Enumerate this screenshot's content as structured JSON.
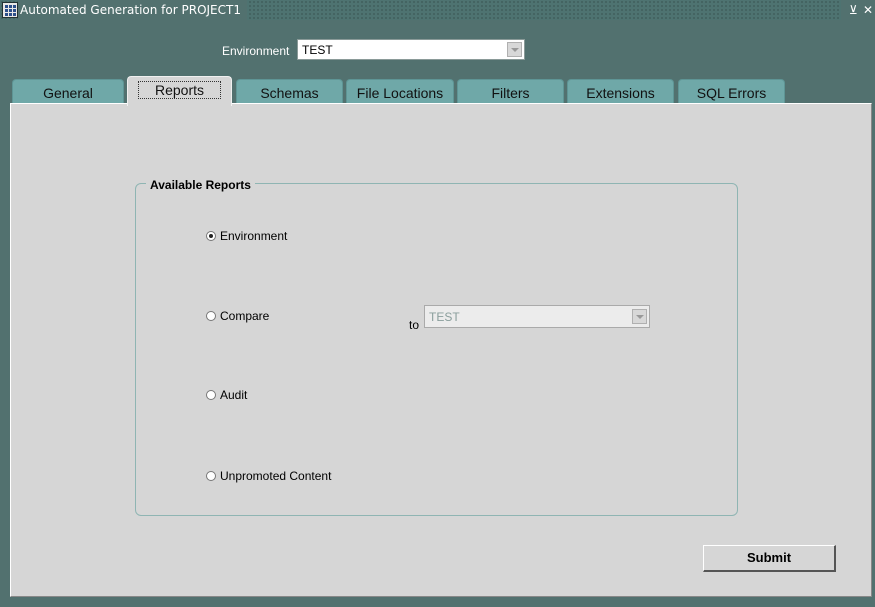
{
  "window": {
    "title": "Automated Generation for PROJECT1",
    "buttons": {
      "minimize": "⊻",
      "close": "✕"
    }
  },
  "environment": {
    "label": "Environment",
    "value": "TEST"
  },
  "tabs": [
    {
      "label": "General",
      "active": false
    },
    {
      "label": "Reports",
      "active": true
    },
    {
      "label": "Schemas",
      "active": false
    },
    {
      "label": "File Locations",
      "active": false
    },
    {
      "label": "Filters",
      "active": false
    },
    {
      "label": "Extensions",
      "active": false
    },
    {
      "label": "SQL Errors",
      "active": false
    }
  ],
  "reports": {
    "group_title": "Available Reports",
    "options": [
      {
        "label": "Environment",
        "selected": true
      },
      {
        "label": "Compare",
        "selected": false
      },
      {
        "label": "Audit",
        "selected": false
      },
      {
        "label": "Unpromoted Content",
        "selected": false
      }
    ],
    "compare_to_label": "to",
    "compare_to_value": "TEST"
  },
  "submit_label": "Submit",
  "colors": {
    "frame": "#52716f",
    "tab": "#6fa8a8",
    "panel": "#d6d6d6",
    "group_border": "#8fb5b3"
  }
}
